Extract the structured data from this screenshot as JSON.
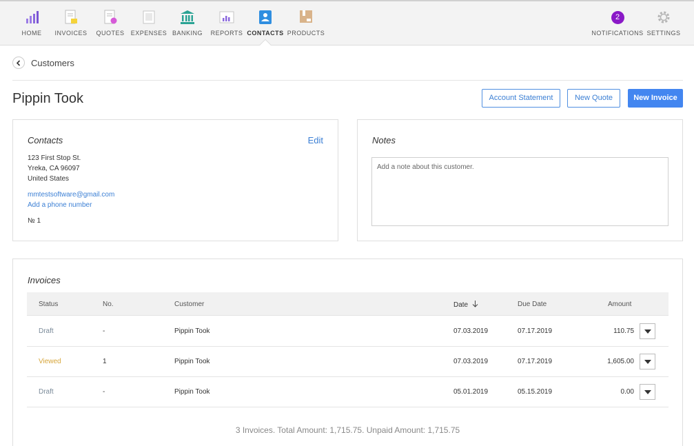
{
  "nav": {
    "items": [
      {
        "label": "HOME",
        "icon": "home-chart-icon"
      },
      {
        "label": "INVOICES",
        "icon": "invoice-icon"
      },
      {
        "label": "QUOTES",
        "icon": "quote-icon"
      },
      {
        "label": "EXPENSES",
        "icon": "expenses-icon"
      },
      {
        "label": "BANKING",
        "icon": "bank-icon"
      },
      {
        "label": "REPORTS",
        "icon": "reports-icon"
      },
      {
        "label": "CONTACTS",
        "icon": "contacts-icon"
      },
      {
        "label": "PRODUCTS",
        "icon": "products-icon"
      }
    ],
    "active": "CONTACTS",
    "notifications": {
      "label": "NOTIFICATIONS",
      "count": "2"
    },
    "settings": {
      "label": "SETTINGS",
      "icon": "gear-icon"
    }
  },
  "breadcrumb": {
    "label": "Customers"
  },
  "page": {
    "title": "Pippin Took"
  },
  "actions": {
    "account_statement": "Account Statement",
    "new_quote": "New Quote",
    "new_invoice": "New Invoice"
  },
  "contacts": {
    "title": "Contacts",
    "edit": "Edit",
    "address1": "123 First Stop St.",
    "address2": "Yreka, CA 96097",
    "country": "United States",
    "email": "mmtestsoftware@gmail.com",
    "add_phone": "Add a phone number",
    "number": "№ 1"
  },
  "notes": {
    "title": "Notes",
    "placeholder": "Add a note about this customer."
  },
  "invoices": {
    "title": "Invoices",
    "columns": {
      "status": "Status",
      "no": "No.",
      "customer": "Customer",
      "date": "Date",
      "due_date": "Due Date",
      "amount": "Amount"
    },
    "rows": [
      {
        "status": "Draft",
        "no": "-",
        "customer": "Pippin Took",
        "date": "07.03.2019",
        "due_date": "07.17.2019",
        "amount": "110.75"
      },
      {
        "status": "Viewed",
        "no": "1",
        "customer": "Pippin Took",
        "date": "07.03.2019",
        "due_date": "07.17.2019",
        "amount": "1,605.00"
      },
      {
        "status": "Draft",
        "no": "-",
        "customer": "Pippin Took",
        "date": "05.01.2019",
        "due_date": "05.15.2019",
        "amount": "0.00"
      }
    ],
    "summary": "3 Invoices. Total Amount: 1,715.75. Unpaid Amount: 1,715.75"
  },
  "colors": {
    "accent": "#4386f0",
    "draft": "#7a8a99",
    "viewed": "#d6a53a",
    "notification": "#8a19c7"
  }
}
